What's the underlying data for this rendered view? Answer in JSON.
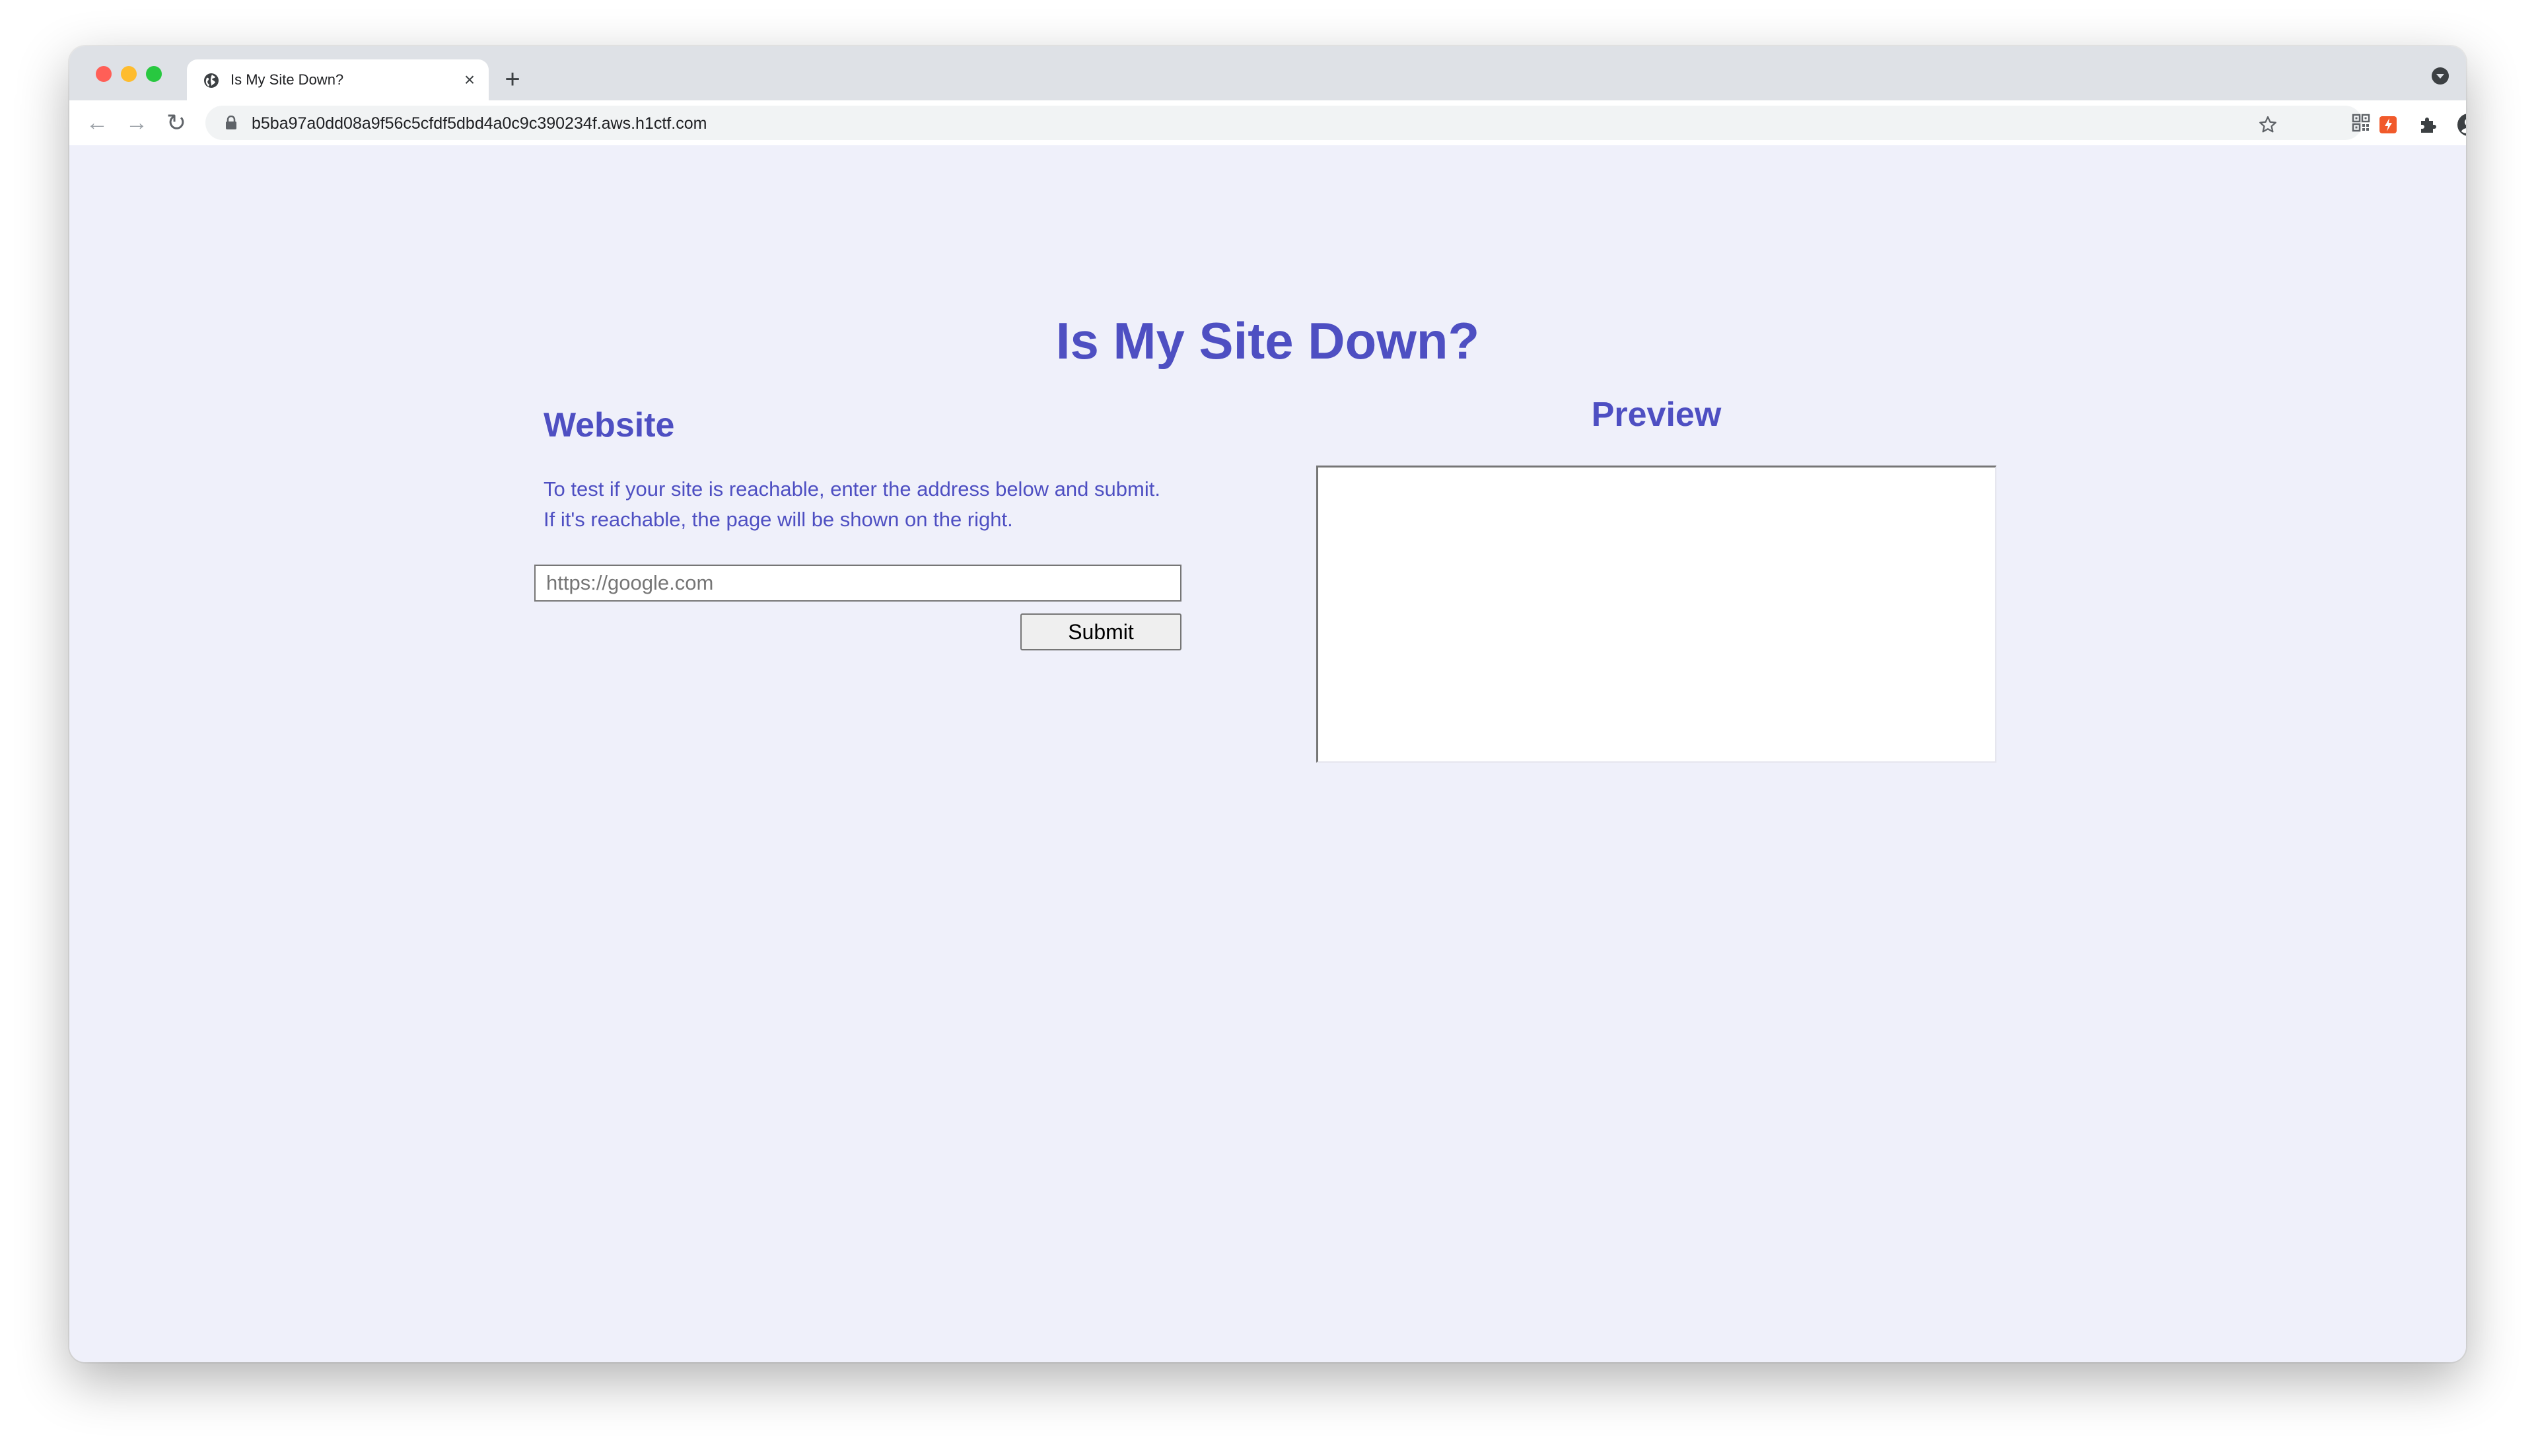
{
  "browser": {
    "tab": {
      "title": "Is My Site Down?",
      "favicon": "globe-icon",
      "close_icon": "close-icon"
    },
    "new_tab_icon": "plus-icon",
    "tab_search_icon": "chevron-down-circle-icon",
    "toolbar": {
      "back_icon": "arrow-left-icon",
      "forward_icon": "arrow-right-icon",
      "reload_icon": "reload-icon"
    },
    "omnibox": {
      "url": "b5ba97a0dd08a9f56c5cfdf5dbd4a0c9c390234f.aws.h1ctf.com",
      "lock_icon": "lock-icon",
      "qr_icon": "qr-code-icon",
      "bookmark_icon": "star-icon"
    },
    "extensions": [
      "extension-badge-icon",
      "puzzle-icon",
      "profile-icon",
      "more-vertical-icon"
    ]
  },
  "page": {
    "title": "Is My Site Down?",
    "website": {
      "heading": "Website",
      "description_line1": "To test if your site is reachable, enter the address below and submit.",
      "description_line2": "If it's reachable, the page will be shown on the right.",
      "input_placeholder": "https://google.com",
      "input_value": "",
      "submit_label": "Submit"
    },
    "preview": {
      "heading": "Preview"
    }
  },
  "colors": {
    "accent": "#4e4fc2",
    "page_background": "#eff0fa",
    "tabstrip": "#dee1e6",
    "extension_badge": "#f15a2b"
  }
}
